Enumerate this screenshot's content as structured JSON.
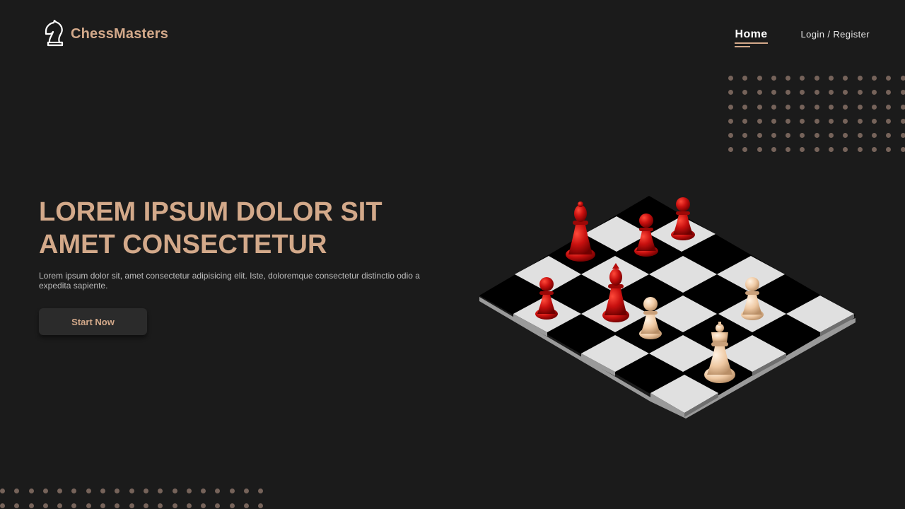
{
  "brand": {
    "name": "ChessMasters",
    "icon": "knight-icon"
  },
  "nav": {
    "home": "Home",
    "login": "Login / Register"
  },
  "hero": {
    "title_line1": "LOREM IPSUM DOLOR SIT",
    "title_line2": "AMET CONSECTETUR",
    "text": "Lorem ipsum dolor sit, amet consectetur adipisicing elit. Iste, doloremque consectetur distinctio odio a expedita sapiente.",
    "cta": "Start Now"
  },
  "colors": {
    "accent": "#d3a98a",
    "background": "#1b1b1b",
    "red_pieces": "#c8100f",
    "light_pieces": "#eec8a2"
  },
  "board": {
    "squares_light": "#e0e0e0",
    "squares_dark": "#000000",
    "pieces": [
      {
        "type": "bishop",
        "color": "red"
      },
      {
        "type": "pawn",
        "color": "red"
      },
      {
        "type": "pawn",
        "color": "red"
      },
      {
        "type": "pawn",
        "color": "red"
      },
      {
        "type": "bishop",
        "color": "red"
      },
      {
        "type": "pawn",
        "color": "light"
      },
      {
        "type": "pawn",
        "color": "light"
      },
      {
        "type": "king",
        "color": "light"
      }
    ]
  }
}
